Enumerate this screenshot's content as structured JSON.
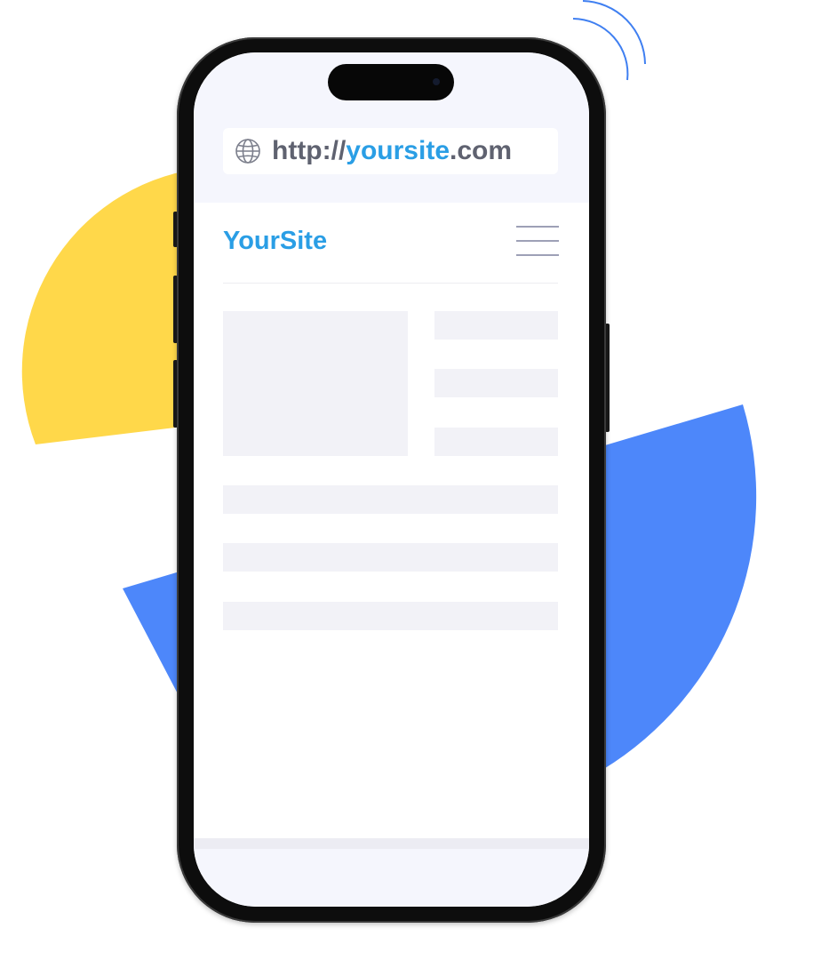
{
  "browser": {
    "url_prefix": "http://",
    "url_domain": "yoursite",
    "url_suffix": ".com",
    "globe_icon": "globe-icon"
  },
  "site": {
    "logo_text": "YourSite",
    "menu_icon": "hamburger-menu-icon"
  },
  "colors": {
    "accent": "#2a9ee5",
    "url_text": "#5f6270",
    "decor_yellow": "#ffd84a",
    "decor_blue": "#4d87fa",
    "signal_lines": "#3f7ff1",
    "placeholder": "#f2f2f7"
  }
}
